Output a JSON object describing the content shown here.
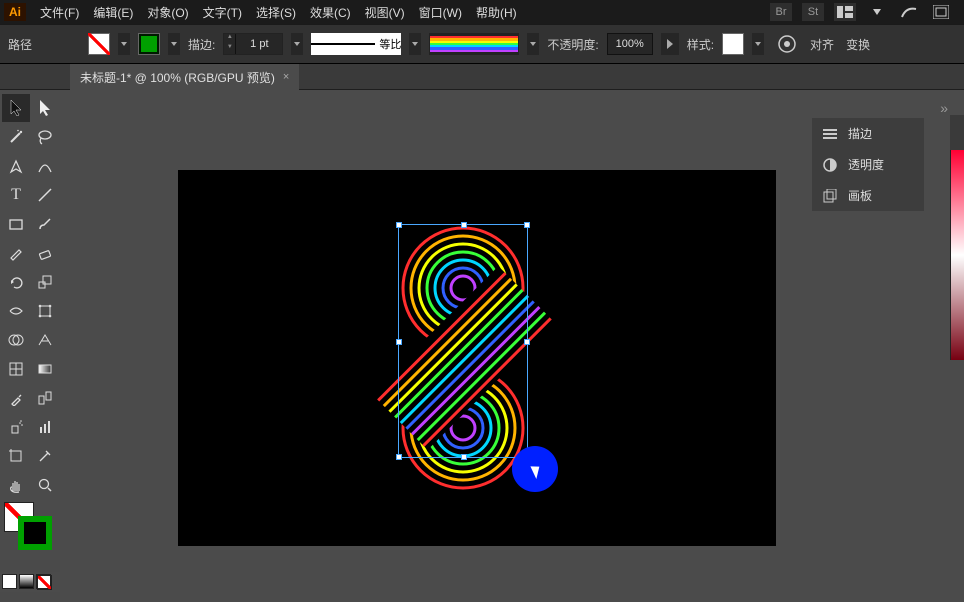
{
  "app": {
    "logo": "Ai"
  },
  "menu": {
    "file": "文件(F)",
    "edit": "编辑(E)",
    "object": "对象(O)",
    "text": "文字(T)",
    "select": "选择(S)",
    "effect": "效果(C)",
    "view": "视图(V)",
    "window": "窗口(W)",
    "help": "帮助(H)"
  },
  "menubar_right": {
    "br": "Br",
    "st": "St"
  },
  "control": {
    "path_label": "路径",
    "stroke_label": "描边:",
    "stroke_value": "1 pt",
    "profile_label": "等比",
    "opacity_label": "不透明度:",
    "opacity_value": "100%",
    "style_label": "样式:",
    "align_label": "对齐",
    "transform_label": "变换"
  },
  "doc_tab": {
    "title": "未标题-1* @ 100% (RGB/GPU 预览)",
    "close": "×"
  },
  "right_panel": {
    "stroke": "描边",
    "opacity": "透明度",
    "artboard": "画板"
  },
  "rainbow_colors": [
    "#ff2e2e",
    "#ffb400",
    "#f6ff00",
    "#38ff38",
    "#00d6ff",
    "#3060ff",
    "#c040ff"
  ]
}
